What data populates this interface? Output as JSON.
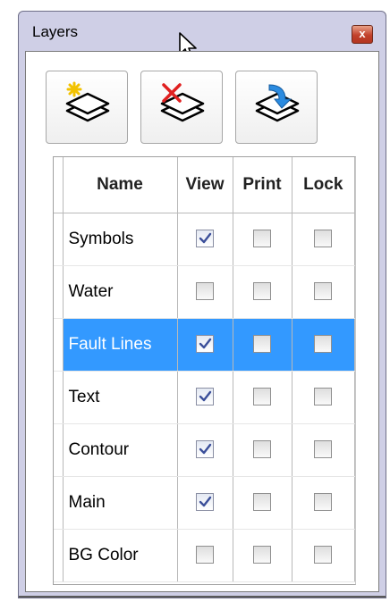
{
  "window": {
    "title": "Layers",
    "close_label": "x"
  },
  "toolbar": {
    "buttons": [
      {
        "icon": "new-layer-icon"
      },
      {
        "icon": "delete-layer-icon"
      },
      {
        "icon": "merge-layer-icon"
      }
    ]
  },
  "table": {
    "headers": {
      "name": "Name",
      "view": "View",
      "print": "Print",
      "lock": "Lock"
    },
    "rows": [
      {
        "name": "Symbols",
        "view": true,
        "print": false,
        "lock": false,
        "selected": false
      },
      {
        "name": "Water",
        "view": false,
        "print": false,
        "lock": false,
        "selected": false
      },
      {
        "name": "Fault Lines",
        "view": true,
        "print": false,
        "lock": false,
        "selected": true
      },
      {
        "name": "Text",
        "view": true,
        "print": false,
        "lock": false,
        "selected": false
      },
      {
        "name": "Contour",
        "view": true,
        "print": false,
        "lock": false,
        "selected": false
      },
      {
        "name": "Main",
        "view": true,
        "print": false,
        "lock": false,
        "selected": false
      },
      {
        "name": "BG Color",
        "view": false,
        "print": false,
        "lock": false,
        "selected": false
      }
    ]
  },
  "colors": {
    "selection": "#3399ff",
    "window_frame": "#cfcfe6",
    "close_button": "#c2412b"
  }
}
